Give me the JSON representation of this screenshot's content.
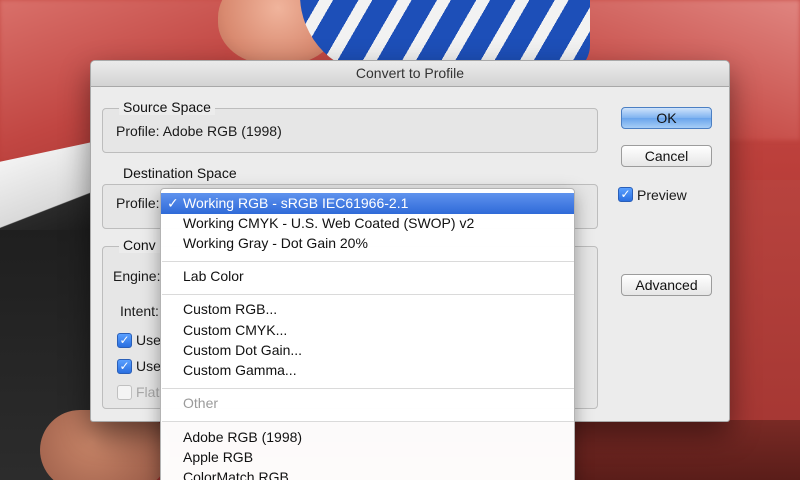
{
  "dialog": {
    "title": "Convert to Profile",
    "source_space": {
      "title": "Source Space",
      "profile_text": "Profile:  Adobe RGB (1998)"
    },
    "destination_space": {
      "title": "Destination Space",
      "profile_label": "Profile:"
    },
    "conversion_options": {
      "title": "Conversion Options",
      "title_visible": "Conv",
      "engine_label": "Engine:",
      "intent_label": "Intent:",
      "checkboxes": [
        {
          "label": "Use",
          "checked": true,
          "enabled": true
        },
        {
          "label": "Use",
          "checked": true,
          "enabled": true
        },
        {
          "label": "Flat",
          "checked": false,
          "enabled": false
        }
      ]
    },
    "buttons": {
      "ok": "OK",
      "cancel": "Cancel",
      "advanced": "Advanced"
    },
    "preview": {
      "label": "Preview",
      "checked": true
    }
  },
  "profile_menu": {
    "selected_index": 0,
    "items": [
      {
        "label": "Working RGB - sRGB IEC61966-2.1",
        "selected": true
      },
      {
        "label": "Working CMYK - U.S. Web Coated (SWOP) v2"
      },
      {
        "label": "Working Gray - Dot Gain 20%"
      },
      {
        "label": "Lab Color"
      },
      {
        "label": "Custom RGB..."
      },
      {
        "label": "Custom CMYK..."
      },
      {
        "label": "Custom Dot Gain..."
      },
      {
        "label": "Custom Gamma..."
      },
      {
        "label": "Other",
        "header": true
      },
      {
        "label": "Adobe RGB (1998)"
      },
      {
        "label": "Apple RGB"
      },
      {
        "label": "ColorMatch RGB"
      }
    ],
    "check_glyph": "✓"
  },
  "colors": {
    "accent": "#2f6ad8",
    "dialog_bg": "#ececec",
    "header_text": "#9a9a9a"
  }
}
